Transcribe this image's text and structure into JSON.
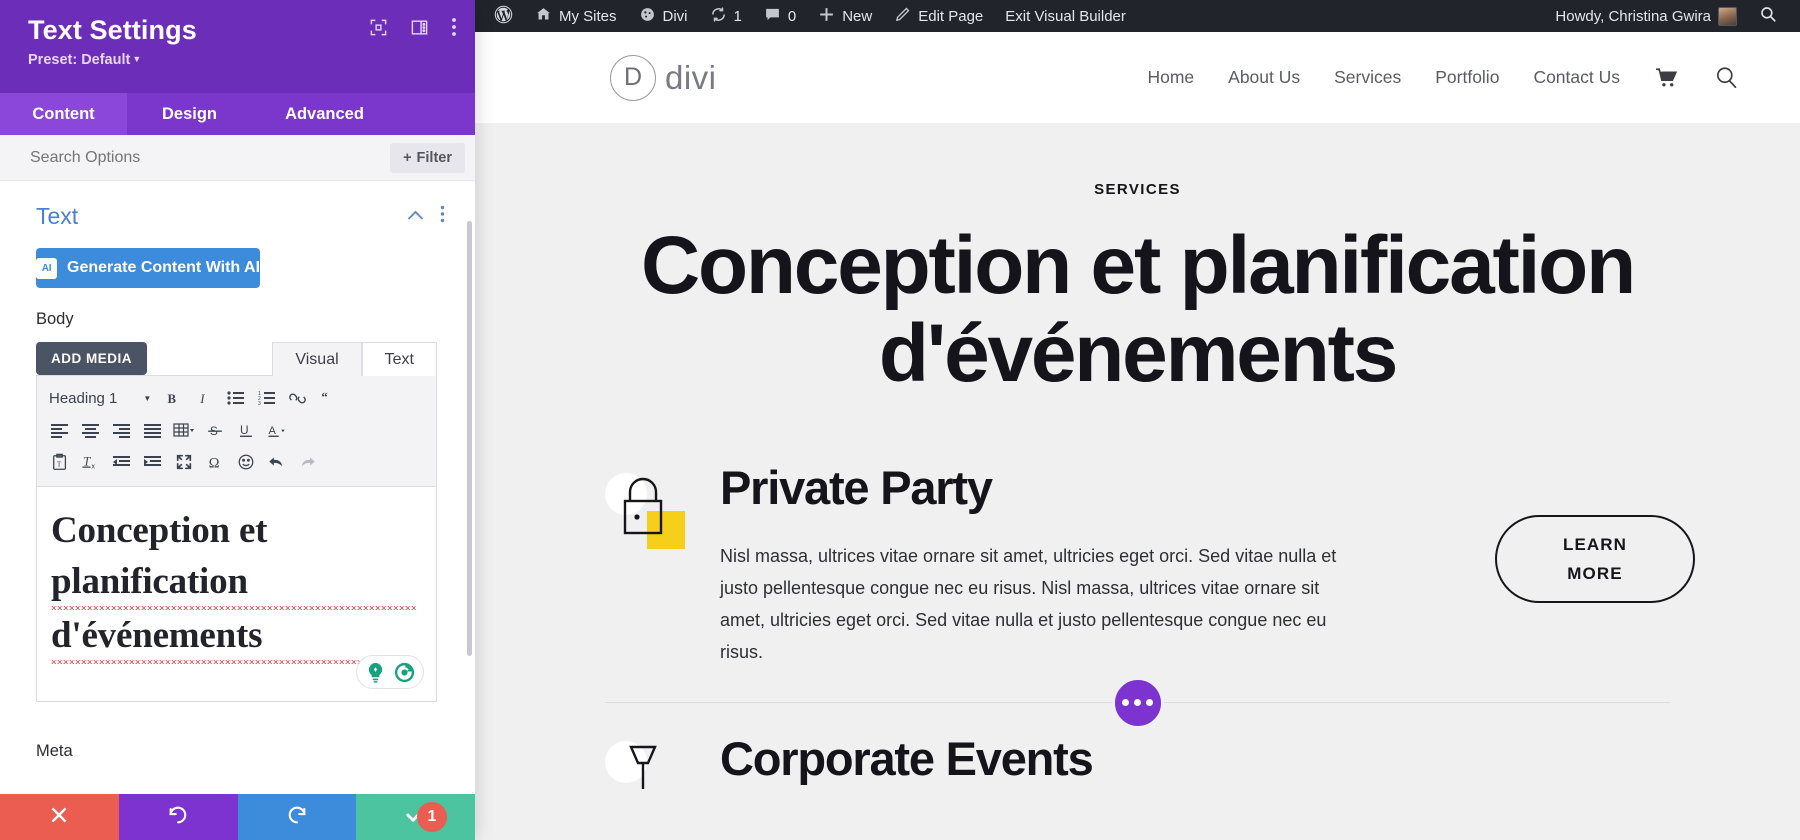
{
  "settings_panel": {
    "title": "Text Settings",
    "preset": "Preset: Default",
    "header_icons": [
      {
        "name": "fullscreen-icon"
      },
      {
        "name": "layout-columns-icon"
      },
      {
        "name": "more-vertical-icon"
      }
    ],
    "tabs": [
      {
        "label": "Content",
        "active": true
      },
      {
        "label": "Design",
        "active": false
      },
      {
        "label": "Advanced",
        "active": false
      }
    ],
    "search_placeholder": "Search Options",
    "filter_label": "Filter",
    "filter_icon": "plus-icon",
    "section": {
      "title": "Text",
      "collapse_icon": "chevron-up-icon",
      "menu_icon": "more-vertical-icon"
    },
    "ai_button": {
      "label": "Generate Content With AI",
      "badge": "AI",
      "color": "#3c8cdb"
    },
    "body_label": "Body",
    "add_media_label": "ADD MEDIA",
    "editor_tabs": [
      {
        "label": "Visual",
        "active": true
      },
      {
        "label": "Text",
        "active": false
      }
    ],
    "toolbar": {
      "format_select": "Heading 1",
      "row1": [
        "bold-icon",
        "italic-icon",
        "bulleted-list-icon",
        "numbered-list-icon",
        "link-icon",
        "blockquote-icon"
      ],
      "row2": [
        "align-left-icon",
        "align-center-icon",
        "align-right-icon",
        "align-justify-icon",
        "table-icon",
        "strikethrough-icon",
        "underline-icon",
        "text-color-icon"
      ],
      "row3": [
        "paste-as-text-icon",
        "clear-formatting-icon",
        "outdent-icon",
        "indent-icon",
        "fullscreen-icon",
        "special-character-icon",
        "emoji-icon",
        "undo-icon",
        "redo-icon"
      ]
    },
    "editor_content_lines": [
      "Conception et",
      "planification",
      "d'événements"
    ],
    "grammarly_icons": [
      "grammarly-suggestion-icon",
      "grammarly-logo-icon"
    ],
    "next_field_label": "Meta",
    "footer_buttons": [
      {
        "name": "cancel-button",
        "icon": "close-icon",
        "color": "#eb5c51"
      },
      {
        "name": "undo-button",
        "icon": "undo-icon",
        "color": "#7d33cf"
      },
      {
        "name": "redo-button",
        "icon": "redo-icon",
        "color": "#3c8cdb"
      },
      {
        "name": "save-button",
        "icon": "check-icon",
        "color": "#4dc4a0",
        "badge": "1"
      }
    ]
  },
  "admin_bar": {
    "items": [
      {
        "label": "",
        "icon": "wordpress-logo-icon"
      },
      {
        "label": "My Sites",
        "icon": "sites-icon"
      },
      {
        "label": "Divi",
        "icon": "divi-icon"
      },
      {
        "label": "1",
        "icon": "updates-icon"
      },
      {
        "label": "0",
        "icon": "comments-icon"
      },
      {
        "label": "New",
        "icon": "plus-icon"
      },
      {
        "label": "Edit Page",
        "icon": "pencil-icon"
      },
      {
        "label": "Exit Visual Builder",
        "icon": ""
      }
    ],
    "howdy": "Howdy, Christina Gwira",
    "avatar": "user-avatar",
    "search_icon": "search-icon"
  },
  "site": {
    "logo_mark": "D",
    "logo_text": "divi",
    "nav": [
      "Home",
      "About Us",
      "Services",
      "Portfolio",
      "Contact Us"
    ],
    "cart_icon": "shopping-cart-icon",
    "search_icon": "search-icon",
    "hero": {
      "eyebrow": "SERVICES",
      "heading": "Conception et planification d'événements"
    },
    "services": [
      {
        "icon": "lock-icon",
        "title": "Private Party",
        "body": "Nisl massa, ultrices vitae ornare sit amet, ultricies eget orci. Sed vitae nulla et justo pellentesque congue nec eu risus. Nisl massa, ultrices vitae ornare sit amet, ultricies eget orci. Sed vitae nulla et justo pellentesque congue nec eu risus.",
        "button_line1": "LEARN",
        "button_line2": "MORE"
      },
      {
        "icon": "table-lamp-icon",
        "title": "Corporate Events"
      }
    ],
    "row_settings_icon": "ellipsis-icon",
    "accent_purple": "#7d33cf",
    "accent_yellow": "#f5cf19",
    "page_bg": "#f0f0f0"
  }
}
